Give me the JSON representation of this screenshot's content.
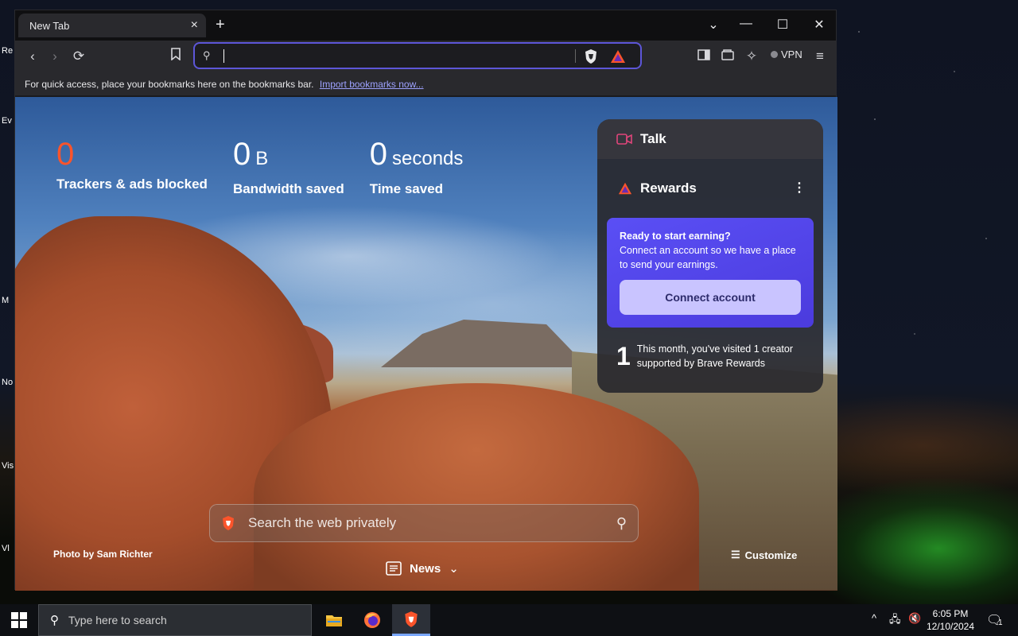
{
  "browser": {
    "tab_title": "New Tab",
    "tab_close": "×",
    "new_tab": "+",
    "window_controls": {
      "tab_search": "⌄",
      "minimize": "—",
      "maximize": "☐",
      "close": "✕"
    },
    "omnibox": {
      "value": "",
      "placeholder": ""
    },
    "vpn_label": "VPN",
    "bookmarks_bar": {
      "text": "For quick access, place your bookmarks here on the bookmarks bar.",
      "import_link": "Import bookmarks now..."
    },
    "accent_color": "#5d56d8"
  },
  "new_tab_page": {
    "stats": {
      "trackers": {
        "value": "0",
        "label": "Trackers & ads blocked"
      },
      "bandwidth": {
        "value": "0",
        "unit": "B",
        "label": "Bandwidth saved"
      },
      "time": {
        "value": "0",
        "unit": "seconds",
        "label": "Time saved"
      }
    },
    "widgets": {
      "talk_title": "Talk",
      "rewards_title": "Rewards",
      "earn_card": {
        "title": "Ready to start earning?",
        "body": "Connect an account so we have a place to send your earnings.",
        "button": "Connect account"
      },
      "visited": {
        "count": "1",
        "text": "This month, you've visited 1 creator supported by Brave Rewards"
      }
    },
    "search_placeholder": "Search the web privately",
    "photo_credit": "Photo by Sam Richter",
    "customize_label": "Customize",
    "news_label": "News"
  },
  "taskbar": {
    "search_placeholder": "Type here to search",
    "time": "6:05 PM",
    "date": "12/10/2024",
    "notification_count": "1"
  }
}
